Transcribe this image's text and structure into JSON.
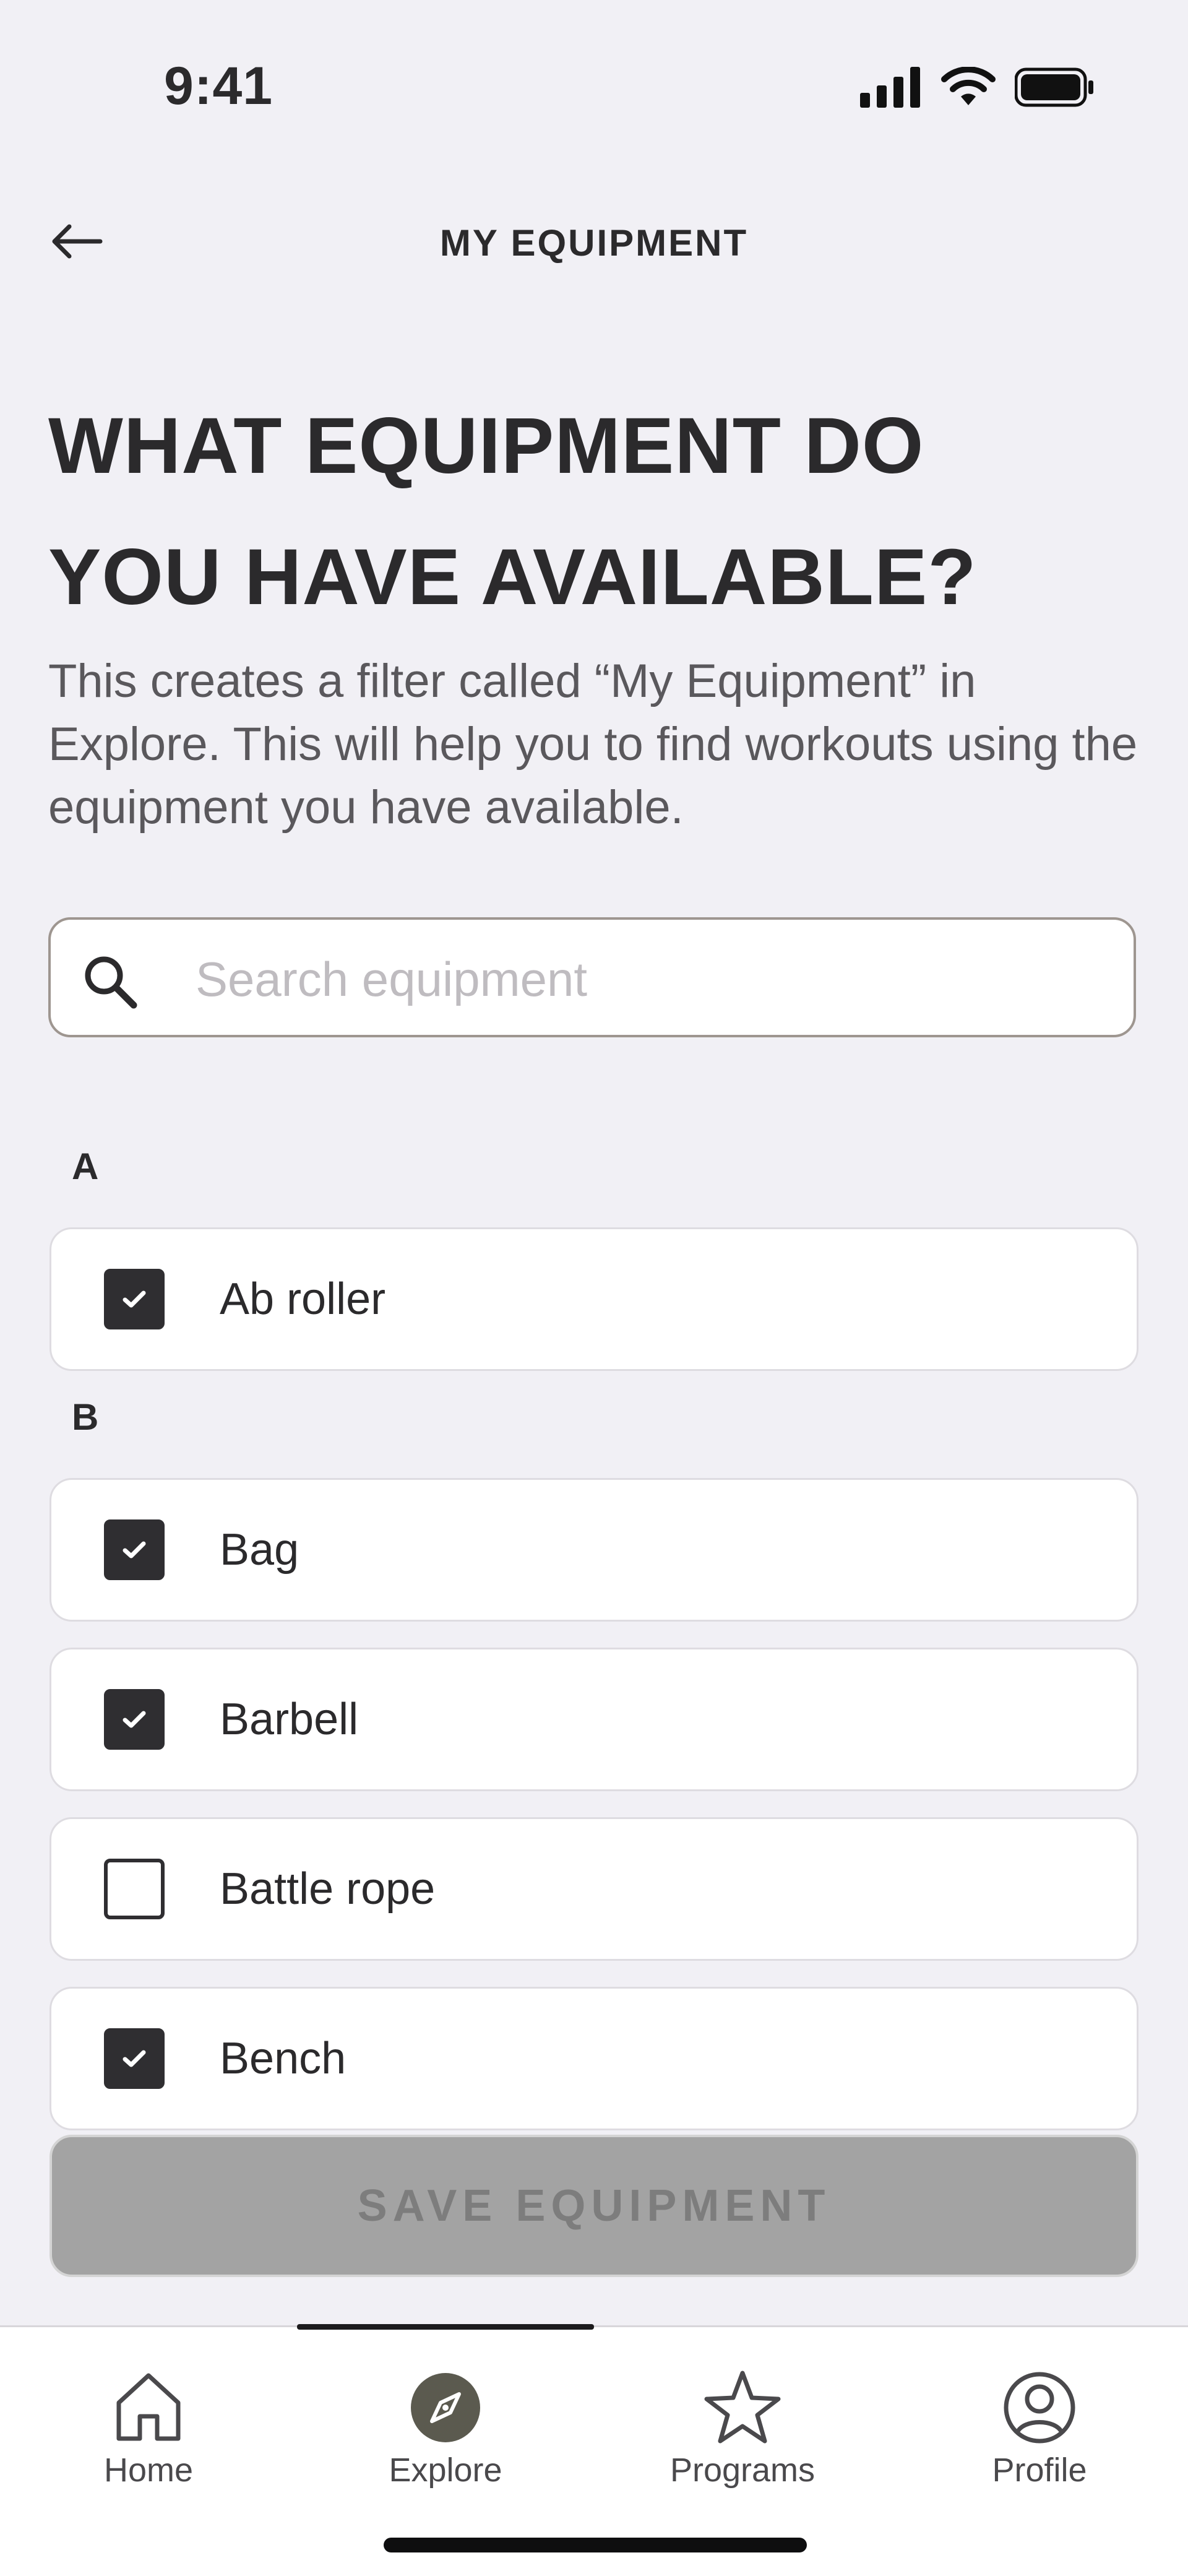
{
  "status_bar": {
    "time": "9:41"
  },
  "header": {
    "title": "MY EQUIPMENT"
  },
  "headline": {
    "line1": "WHAT EQUIPMENT DO",
    "line2": "YOU HAVE AVAILABLE?"
  },
  "description": "This creates a filter called “My Equipment” in Explore. This will help you to find workouts using the equipment you have available.",
  "search": {
    "placeholder": "Search equipment",
    "value": ""
  },
  "sections": [
    {
      "letter": "A",
      "items": [
        {
          "label": "Ab roller",
          "checked": true
        }
      ]
    },
    {
      "letter": "B",
      "items": [
        {
          "label": "Bag",
          "checked": true
        },
        {
          "label": "Barbell",
          "checked": true
        },
        {
          "label": "Battle rope",
          "checked": false
        },
        {
          "label": "Bench",
          "checked": true
        }
      ]
    }
  ],
  "save_button": {
    "label": "SAVE EQUIPMENT",
    "enabled": false
  },
  "tab_bar": {
    "active": "Explore",
    "tabs": [
      {
        "label": "Home",
        "icon": "home-icon"
      },
      {
        "label": "Explore",
        "icon": "compass-icon"
      },
      {
        "label": "Programs",
        "icon": "star-icon"
      },
      {
        "label": "Profile",
        "icon": "profile-icon"
      }
    ]
  },
  "colors": {
    "background": "#f1f0f5",
    "text": "#2b2a2c",
    "checkbox": "#2f2e31",
    "button_disabled": "#a3a3a3",
    "explore_accent": "#5b5a4f"
  }
}
